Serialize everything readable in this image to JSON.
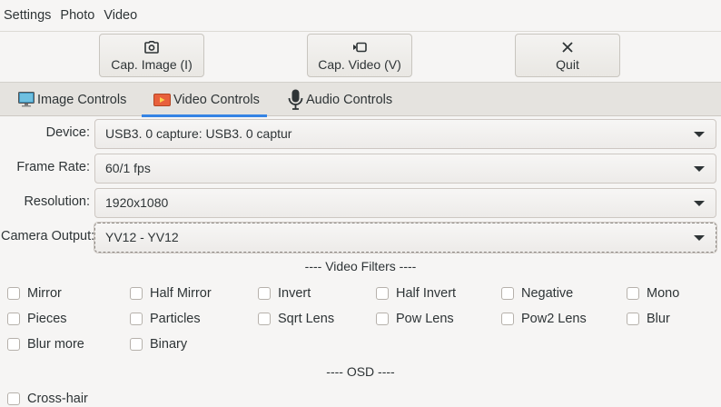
{
  "menu": [
    "Settings",
    "Photo",
    "Video"
  ],
  "toolbar": {
    "capture_image": {
      "label": "Cap. Image (I)",
      "icon": "camera-icon"
    },
    "capture_video": {
      "label": "Cap. Video (V)",
      "icon": "video-camera-icon"
    },
    "quit": {
      "label": "Quit",
      "icon": "close-icon"
    }
  },
  "tabs": [
    {
      "label": "Image Controls",
      "icon": "monitor-icon"
    },
    {
      "label": "Video Controls",
      "icon": "video-icon",
      "active": true
    },
    {
      "label": "Audio Controls",
      "icon": "microphone-icon"
    }
  ],
  "form": {
    "device": {
      "label": "Device:",
      "value": "USB3. 0 capture: USB3. 0 captur"
    },
    "frame_rate": {
      "label": "Frame Rate:",
      "value": "60/1 fps"
    },
    "resolution": {
      "label": "Resolution:",
      "value": "1920x1080"
    },
    "camera_output": {
      "label": "Camera Output:",
      "value": "YV12 - YV12"
    }
  },
  "video_filters_title": "---- Video Filters ----",
  "filters": [
    "Mirror",
    "Half Mirror",
    "Invert",
    "Half Invert",
    "Negative",
    "Mono",
    "Pieces",
    "Particles",
    "Sqrt Lens",
    "Pow Lens",
    "Pow2 Lens",
    "Blur",
    "Blur more",
    "Binary"
  ],
  "osd_title": "---- OSD ----",
  "osd": [
    "Cross-hair"
  ],
  "colors": {
    "accent": "#3584e4",
    "background": "#f6f5f4",
    "tabbar": "#e5e3df"
  }
}
